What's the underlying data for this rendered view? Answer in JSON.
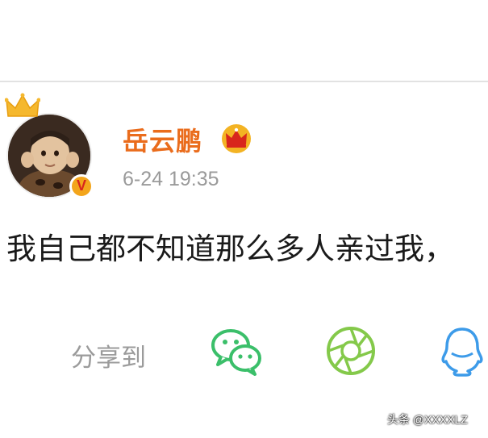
{
  "post": {
    "username": "岳云鹏",
    "timestamp": "6-24 19:35",
    "text": "我自己都不知道那么多人亲过我，"
  },
  "share": {
    "label": "分享到",
    "targets": [
      {
        "icon": "wechat-icon"
      },
      {
        "icon": "moments-icon"
      },
      {
        "icon": "qq-icon"
      }
    ]
  },
  "badges": {
    "verified_letter": "V"
  },
  "colors": {
    "username": "#ea6c1c",
    "timestamp": "#9a9a9a",
    "share_label": "#9b9b9b",
    "wechat": "#3bbf6a",
    "moments": "#84c94a",
    "qq": "#3d9be9",
    "crown": "#f3a51b"
  },
  "watermark": "头条 @XXXXLZ"
}
